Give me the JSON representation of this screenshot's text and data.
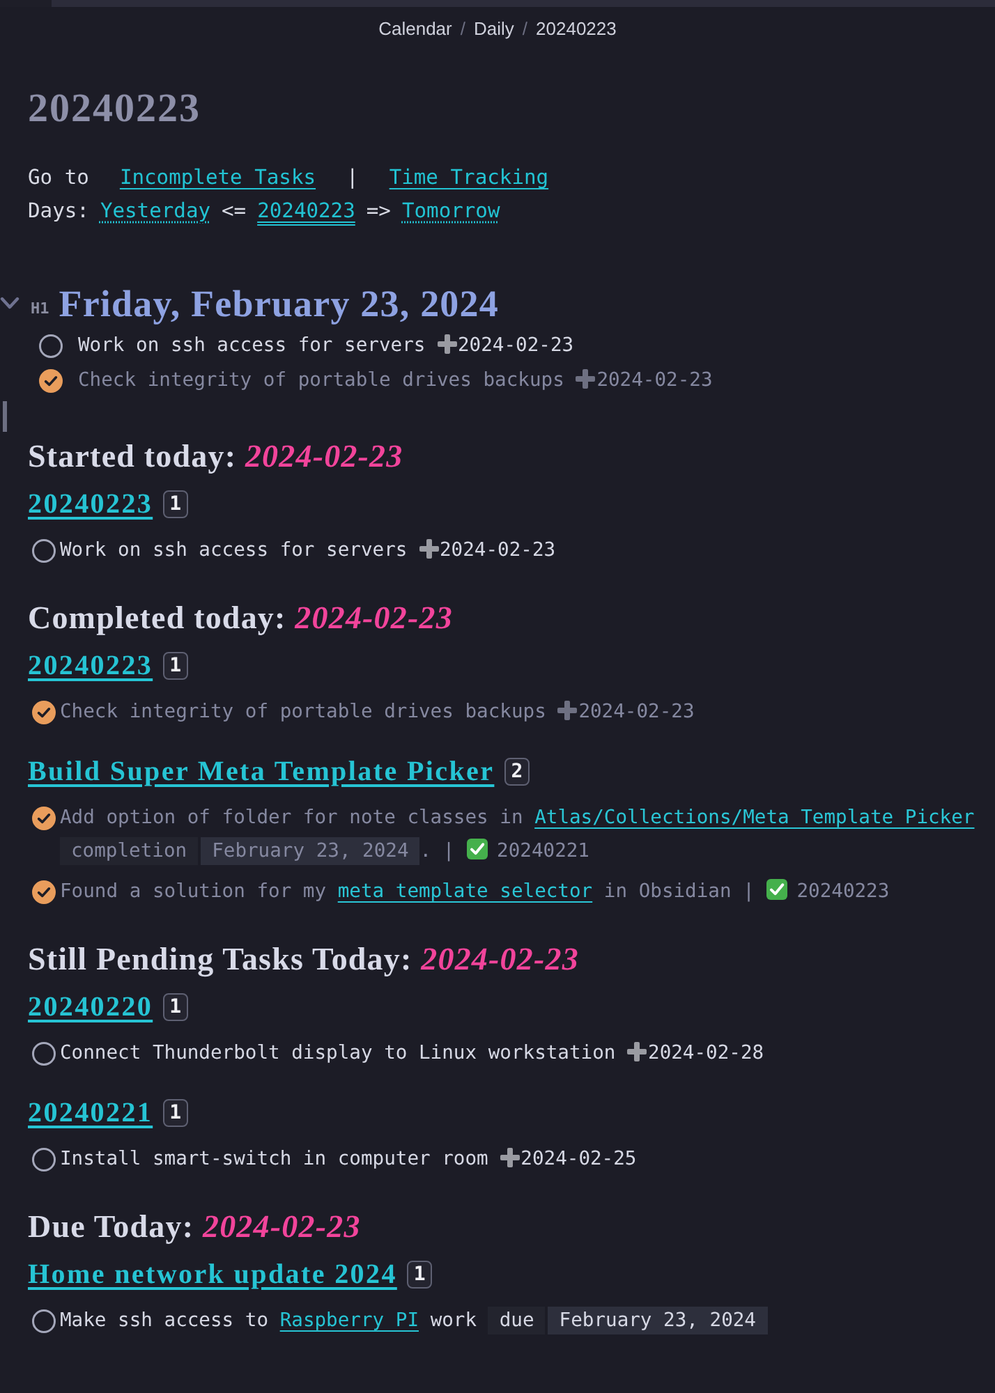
{
  "breadcrumb": [
    {
      "kind": "crumb",
      "text": "Calendar"
    },
    {
      "kind": "separator",
      "text": "/"
    },
    {
      "kind": "crumb",
      "text": "Daily"
    },
    {
      "kind": "separator",
      "text": "/"
    },
    {
      "kind": "crumb",
      "text": "20240223"
    }
  ],
  "title": "20240223",
  "nav_lines": [
    {
      "spaced": true,
      "parts": [
        {
          "kind": "text",
          "text": "Go to"
        },
        {
          "kind": "link",
          "text": "Incomplete Tasks"
        },
        {
          "kind": "text",
          "text": "|"
        },
        {
          "kind": "link",
          "text": "Time Tracking"
        }
      ]
    },
    {
      "spaced": false,
      "parts": [
        {
          "kind": "text",
          "text": "Days:"
        },
        {
          "kind": "unresolved_link",
          "text": "Yesterday"
        },
        {
          "kind": "text",
          "text": "<="
        },
        {
          "kind": "current_link",
          "text": "20240223"
        },
        {
          "kind": "text",
          "text": "=>"
        },
        {
          "kind": "unresolved_link",
          "text": "Tomorrow"
        }
      ]
    }
  ],
  "heading": {
    "level": "H1",
    "text": "Friday, February 23, 2024",
    "expanded": true,
    "tasks": [
      {
        "checked": false,
        "parts": [
          {
            "kind": "text",
            "text": "Work on ssh access for servers "
          },
          {
            "kind": "created",
            "text": "2024-02-23"
          }
        ]
      },
      {
        "checked": true,
        "parts": [
          {
            "kind": "text",
            "text": "Check integrity of portable drives backups "
          },
          {
            "kind": "created",
            "text": "2024-02-23"
          }
        ]
      }
    ]
  },
  "sections": [
    {
      "heading": "Started today:",
      "date": "2024-02-23",
      "groups": [
        {
          "link": "20240223",
          "count": "1",
          "tasks": [
            {
              "checked": false,
              "parts": [
                {
                  "kind": "text",
                  "text": "Work on ssh access for servers "
                },
                {
                  "kind": "created",
                  "text": "2024-02-23"
                }
              ]
            }
          ]
        }
      ]
    },
    {
      "heading": "Completed today:",
      "date": "2024-02-23",
      "groups": [
        {
          "link": "20240223",
          "count": "1",
          "tasks": [
            {
              "checked": true,
              "parts": [
                {
                  "kind": "text",
                  "text": "Check integrity of portable drives backups "
                },
                {
                  "kind": "created",
                  "text": "2024-02-23"
                }
              ]
            }
          ]
        },
        {
          "link": "Build Super Meta Template Picker",
          "count": "2",
          "tasks": [
            {
              "checked": true,
              "parts": [
                {
                  "kind": "text",
                  "text": "Add option of folder for note classes in "
                },
                {
                  "kind": "link",
                  "text": "Atlas/Collections/Meta Template Picker"
                },
                {
                  "kind": "label",
                  "text": "completion"
                },
                {
                  "kind": "value",
                  "text": "February 23, 2024"
                },
                {
                  "kind": "text",
                  "text": ". | "
                },
                {
                  "kind": "done",
                  "text": "20240221"
                }
              ]
            },
            {
              "checked": true,
              "parts": [
                {
                  "kind": "text",
                  "text": "Found a solution for my "
                },
                {
                  "kind": "link",
                  "text": "meta template selector"
                },
                {
                  "kind": "text",
                  "text": " in Obsidian | "
                },
                {
                  "kind": "done",
                  "text": "20240223"
                }
              ]
            }
          ]
        }
      ]
    },
    {
      "heading": "Still Pending Tasks Today:",
      "date": "2024-02-23",
      "groups": [
        {
          "link": "20240220",
          "count": "1",
          "tasks": [
            {
              "checked": false,
              "parts": [
                {
                  "kind": "text",
                  "text": "Connect Thunderbolt display to Linux workstation "
                },
                {
                  "kind": "created",
                  "text": "2024-02-28"
                }
              ]
            }
          ]
        },
        {
          "link": "20240221",
          "count": "1",
          "tasks": [
            {
              "checked": false,
              "parts": [
                {
                  "kind": "text",
                  "text": "Install smart-switch in computer room "
                },
                {
                  "kind": "created",
                  "text": "2024-02-25"
                }
              ]
            }
          ]
        }
      ]
    },
    {
      "heading": "Due Today:",
      "date": "2024-02-23",
      "groups": [
        {
          "link": "Home network update 2024",
          "count": "1",
          "tasks": [
            {
              "checked": false,
              "parts": [
                {
                  "kind": "text",
                  "text": "Make ssh access to "
                },
                {
                  "kind": "link",
                  "text": "Raspberry PI"
                },
                {
                  "kind": "text",
                  "text": " work "
                },
                {
                  "kind": "label",
                  "text": "due"
                },
                {
                  "kind": "value",
                  "text": "February 23, 2024"
                }
              ]
            }
          ]
        }
      ]
    }
  ]
}
